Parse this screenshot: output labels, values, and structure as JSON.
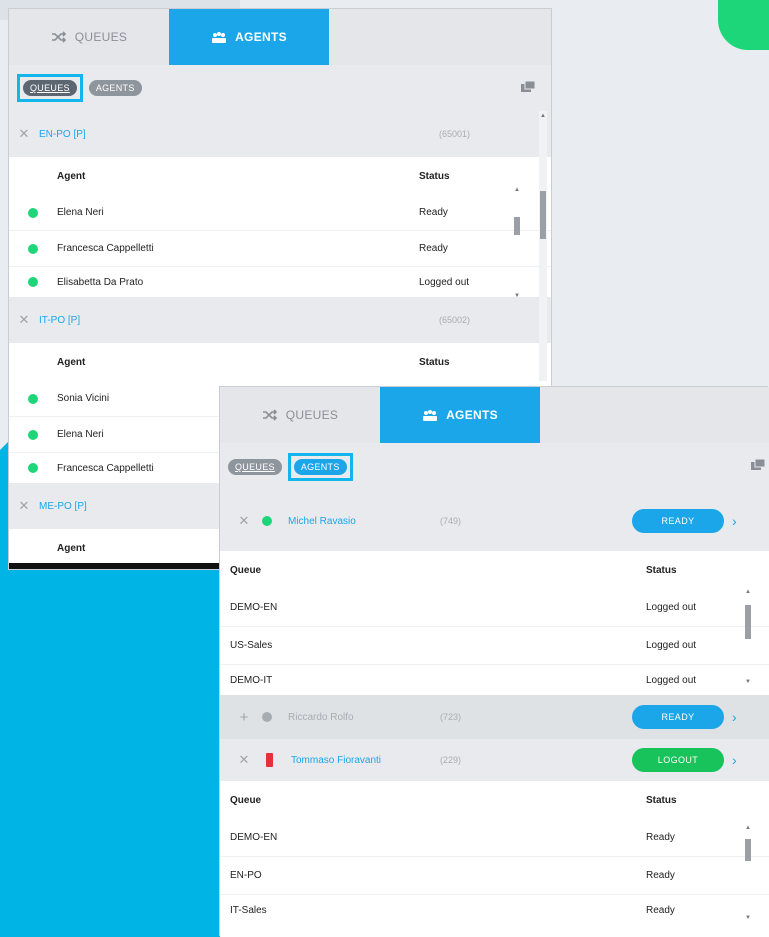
{
  "panel1": {
    "tabs": [
      {
        "label": "QUEUES",
        "icon": "shuffle-icon"
      },
      {
        "label": "AGENTS",
        "icon": "agents-icon"
      }
    ],
    "filters": {
      "queues": "QUEUES",
      "agents": "AGENTS"
    },
    "groups": [
      {
        "name": "EN-PO [P]",
        "ext": "(65001)",
        "columns": {
          "agent": "Agent",
          "status": "Status"
        },
        "rows": [
          {
            "agent": "Elena Neri",
            "status": "Ready"
          },
          {
            "agent": "Francesca Cappelletti",
            "status": "Ready"
          },
          {
            "agent": "Elisabetta Da Prato",
            "status": "Logged out"
          }
        ]
      },
      {
        "name": "IT-PO [P]",
        "ext": "(65002)",
        "columns": {
          "agent": "Agent",
          "status": "Status"
        },
        "rows": [
          {
            "agent": "Sonia Vicini"
          },
          {
            "agent": "Elena Neri"
          },
          {
            "agent": "Francesca Cappelletti"
          }
        ]
      },
      {
        "name": "ME-PO [P]",
        "columns": {
          "agent": "Agent"
        }
      }
    ]
  },
  "panel2": {
    "tabs": [
      {
        "label": "QUEUES",
        "icon": "shuffle-icon"
      },
      {
        "label": "AGENTS",
        "icon": "agents-icon"
      }
    ],
    "filters": {
      "queues": "QUEUES",
      "agents": "AGENTS"
    },
    "agents": [
      {
        "name": "Michel Ravasio",
        "ext": "(749)",
        "button": "READY",
        "columns": {
          "queue": "Queue",
          "status": "Status"
        },
        "rows": [
          {
            "queue": "DEMO-EN",
            "status": "Logged out"
          },
          {
            "queue": "US-Sales",
            "status": "Logged out"
          },
          {
            "queue": "DEMO-IT",
            "status": "Logged out"
          }
        ]
      },
      {
        "name": "Riccardo Rolfo",
        "ext": "(723)",
        "button": "READY"
      },
      {
        "name": "Tommaso Fioravanti",
        "ext": "(229)",
        "button": "LOGOUT",
        "columns": {
          "queue": "Queue",
          "status": "Status"
        },
        "rows": [
          {
            "queue": "DEMO-EN",
            "status": "Ready"
          },
          {
            "queue": "EN-PO",
            "status": "Ready"
          },
          {
            "queue": "IT-Sales",
            "status": "Ready"
          }
        ]
      }
    ]
  },
  "colors": {
    "accent": "#1ca6ea",
    "ready_green": "#1ed67a",
    "logout_green": "#17c35a",
    "phone_red": "#e8303a",
    "highlight": "#12b6ec"
  }
}
